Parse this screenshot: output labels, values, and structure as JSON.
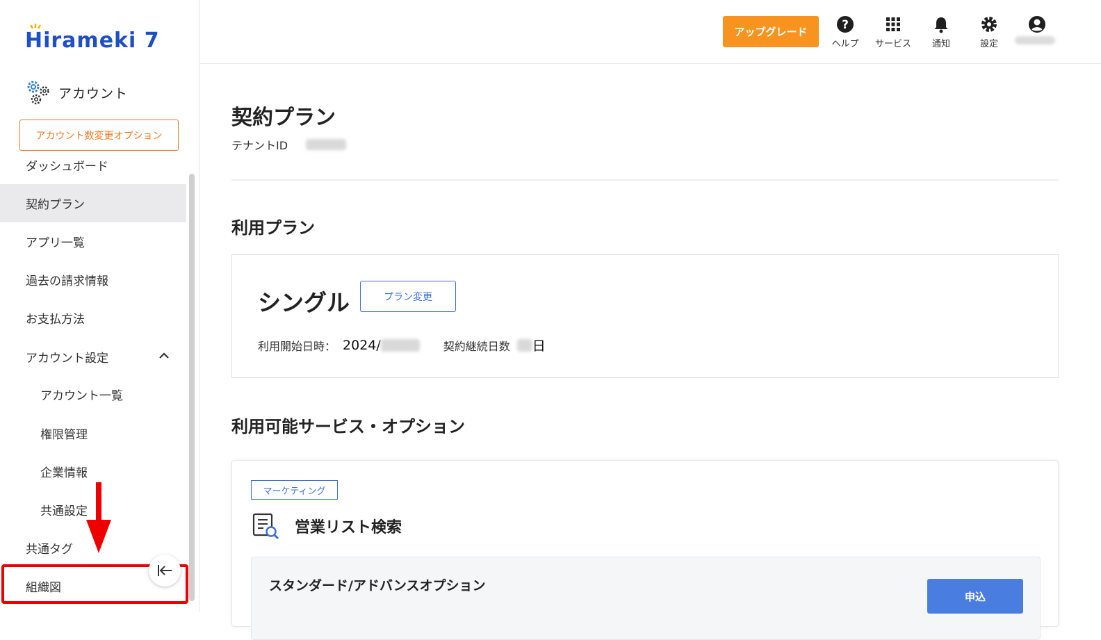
{
  "brand": {
    "logo_text": "Hirameki 7",
    "accent": "#1f4fc4",
    "orange": "#f7931e"
  },
  "sidebar": {
    "section_label": "アカウント",
    "option_button": "アカウント数変更オプション",
    "items": [
      {
        "label": "ダッシュボード"
      },
      {
        "label": "契約プラン",
        "active": true
      },
      {
        "label": "アプリ一覧"
      },
      {
        "label": "過去の請求情報"
      },
      {
        "label": "お支払方法"
      },
      {
        "label": "アカウント設定",
        "expanded": true
      },
      {
        "label": "アカウント一覧"
      },
      {
        "label": "権限管理"
      },
      {
        "label": "企業情報"
      },
      {
        "label": "共通設定"
      },
      {
        "label": "共通タグ"
      },
      {
        "label": "組織図"
      }
    ]
  },
  "header": {
    "upgrade_label": "アップグレード",
    "help_label": "ヘルプ",
    "services_label": "サービス",
    "notify_label": "通知",
    "settings_label": "設定"
  },
  "page": {
    "title": "契約プラン",
    "tenant_label": "テナントID",
    "usage_plan_heading": "利用プラン",
    "plan_name": "シングル",
    "plan_change_label": "プラン変更",
    "start_label": "利用開始日時：",
    "start_value": "2024/",
    "continuous_label": "契約継続日数",
    "day_unit": "日",
    "services_heading": "利用可能サービス・オプション",
    "service_tag": "マーケティング",
    "service_title": "営業リスト検索",
    "option_title": "スタンダード/アドバンスオプション",
    "apply_label": "申込"
  }
}
